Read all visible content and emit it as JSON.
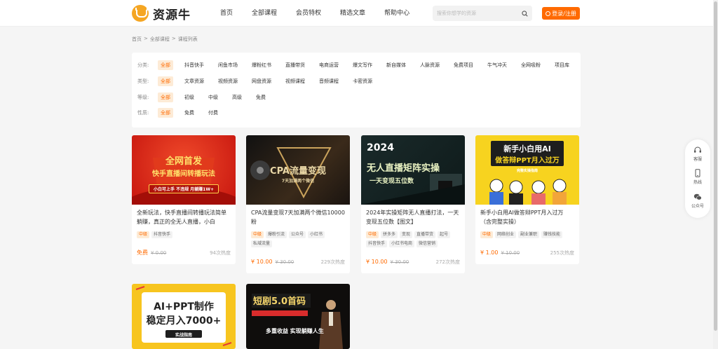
{
  "header": {
    "logo_text": "资源牛",
    "nav": [
      "首页",
      "全部课程",
      "会员特权",
      "精选文章",
      "帮助中心"
    ],
    "search_placeholder": "搜索你想学的资源",
    "login_label": "登录/注册"
  },
  "breadcrumb": [
    "首页",
    ">",
    "全部课程",
    ">",
    "课程列表"
  ],
  "filters": [
    {
      "label": "分类:",
      "options": [
        "全部",
        "抖音快手",
        "闲鱼市场",
        "爆粉红书",
        "直播带货",
        "电商运营",
        "爆文写作",
        "新自媒体",
        "人脉资源",
        "免费项目",
        "牛气冲天",
        "全网吸粉",
        "项目库"
      ],
      "active": 0
    },
    {
      "label": "类型:",
      "options": [
        "全部",
        "文章资源",
        "视频资源",
        "网盘资源",
        "视频课程",
        "音频课程",
        "卡密资源"
      ],
      "active": 0
    },
    {
      "label": "等级:",
      "options": [
        "全部",
        "初级",
        "中级",
        "高级",
        "免费"
      ],
      "active": 0
    },
    {
      "label": "性质:",
      "options": [
        "全部",
        "免费",
        "付费"
      ],
      "active": 0
    }
  ],
  "cards": [
    {
      "cover_lines": [
        "全网首发",
        "快手直播间转播玩法",
        "小白可上手 不违规 月躺赚1W+"
      ],
      "title": "全新玩法，快手直播间转播玩法简单躺赚，真正的全无人直播，小白",
      "tags": [
        "中级",
        "抖音快手"
      ],
      "price": "免费",
      "old_price": "¥ 0.00",
      "heat": "94次热度"
    },
    {
      "cover_lines": [
        "CPA流量变现",
        "7天加满两个微信"
      ],
      "title": "CPA流量变现7天加满两个微信10000粉",
      "tags": [
        "中级",
        "爆粉引流",
        "公众号",
        "小红书",
        "私域流量"
      ],
      "price": "¥ 10.00",
      "old_price": "¥ 30.00",
      "heat": "229次热度"
    },
    {
      "cover_lines": [
        "2024",
        "无人直播矩阵实操",
        "一天变现五位数"
      ],
      "title": "2024年实操矩阵无人直播打法，一天变现五位数【图文】",
      "tags": [
        "中级",
        "拼多多",
        "变现",
        "直播带货",
        "起号",
        "抖音快手",
        "小红书电商",
        "微信营销"
      ],
      "price": "¥ 10.00",
      "old_price": "¥ 30.00",
      "heat": "272次热度"
    },
    {
      "cover_lines": [
        "新手小白用AI",
        "做答辩PPT月入过万",
        "完整实操指南"
      ],
      "title": "新手小白用AI做答辩PPT月入过万（含完整实操）",
      "tags": [
        "中级",
        "网络创业",
        "副业兼职",
        "赚钱技能"
      ],
      "price": "¥ 1.00",
      "old_price": "¥ 10.00",
      "heat": "255次热度"
    },
    {
      "cover_lines": [
        "AI+PPT制作",
        "稳定月入7000+",
        "实战指南"
      ],
      "title": "",
      "tags": [],
      "price": "",
      "old_price": "",
      "heat": ""
    },
    {
      "cover_lines": [
        "短剧5.0首码",
        "多重收益 实现躺赚人生"
      ],
      "title": "",
      "tags": [],
      "price": "",
      "old_price": "",
      "heat": ""
    }
  ],
  "float_bar": [
    "客服",
    "热线",
    "公众号"
  ],
  "colors": {
    "accent": "#ff6a00",
    "accent_light": "#fdebd6"
  }
}
